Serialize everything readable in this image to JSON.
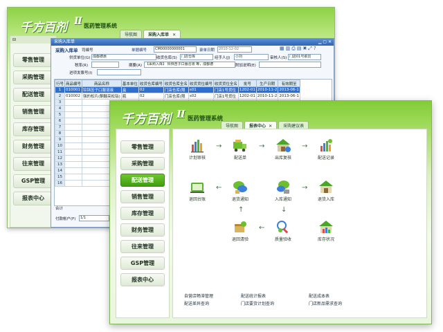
{
  "back_window": {
    "app_title": "医药管理系统",
    "logo_text": "千方百剂",
    "logo_version": "Ⅱ",
    "tabs": [
      {
        "label": "导航图"
      },
      {
        "label": "采购入库单"
      }
    ],
    "side_menu": [
      {
        "label": "零售管理"
      },
      {
        "label": "采购管理"
      },
      {
        "label": "配送管理"
      },
      {
        "label": "销售管理"
      },
      {
        "label": "库存管理"
      },
      {
        "label": "财务管理"
      },
      {
        "label": "往来管理"
      },
      {
        "label": "GSP管理"
      },
      {
        "label": "报表中心"
      }
    ],
    "doc_window": {
      "title": "采购入库单",
      "subtitle": "采购入库单",
      "tiny_label": "司编号",
      "order_no_label": "单据编号",
      "order_no_value": "CM00000000001",
      "date_label": "录单日期",
      "date_value": "2010-12-02",
      "supplier_label": "供货单位(G)",
      "supplier_value": "成都德惠",
      "warehouse_label": "收货仓库(S)",
      "warehouse_value": "门店仓库",
      "handler_label": "经手人(J)",
      "handler_value": "小刘",
      "reviewer_label": "审核人(S)",
      "reviewer_value": "门店01号职员",
      "tax_label": "税率(R)",
      "summary_label": "摘要(A)",
      "summary_value": "【采购入库】 铃铛苦子口服溶液 等，成都德",
      "extra_label": "附加说明(E)",
      "invoice_label": "进项发票号(I)",
      "columns": [
        "行号",
        "商品编号",
        "商品名称",
        "基本单位",
        "收货仓库编号",
        "收货仓库全名",
        "收货货位编号",
        "收货货位全名",
        "批号",
        "生产日期",
        "有效期至"
      ],
      "rows": [
        [
          "1",
          "010001",
          "铃铛苦子口服溶液",
          "盒",
          "02",
          "门店仓库(限",
          "s01",
          "门店1号货位",
          "1202-01",
          "2010-11-2",
          "2013-06-1"
        ],
        [
          "2",
          "010002",
          "强的松片(酮酸亮松钴)",
          "瓶",
          "02",
          "门店仓库(限",
          "s02",
          "门店1号货位",
          "1202-01",
          "2010-11-2",
          "2013-06-1"
        ],
        [
          "3",
          "",
          "",
          "",
          "",
          "",
          "",
          "",
          "",
          "",
          ""
        ],
        [
          "4",
          "",
          "",
          "",
          "",
          "",
          "",
          "",
          "",
          "",
          ""
        ],
        [
          "5",
          "",
          "",
          "",
          "",
          "",
          "",
          "",
          "",
          "",
          ""
        ],
        [
          "6",
          "",
          "",
          "",
          "",
          "",
          "",
          "",
          "",
          "",
          ""
        ],
        [
          "7",
          "",
          "",
          "",
          "",
          "",
          "",
          "",
          "",
          "",
          ""
        ],
        [
          "8",
          "",
          "",
          "",
          "",
          "",
          "",
          "",
          "",
          "",
          ""
        ],
        [
          "9",
          "",
          "",
          "",
          "",
          "",
          "",
          "",
          "",
          "",
          ""
        ],
        [
          "10",
          "",
          "",
          "",
          "",
          "",
          "",
          "",
          "",
          "",
          ""
        ],
        [
          "11",
          "",
          "",
          "",
          "",
          "",
          "",
          "",
          "",
          "",
          ""
        ],
        [
          "12",
          "",
          "",
          "",
          "",
          "",
          "",
          "",
          "",
          "",
          ""
        ],
        [
          "13",
          "",
          "",
          "",
          "",
          "",
          "",
          "",
          "",
          "",
          ""
        ],
        [
          "14",
          "",
          "",
          "",
          "",
          "",
          "",
          "",
          "",
          "",
          ""
        ],
        [
          "15",
          "",
          "",
          "",
          "",
          "",
          "",
          "",
          "",
          "",
          ""
        ],
        [
          "16",
          "",
          "",
          "",
          "",
          "",
          "",
          "",
          "",
          "",
          ""
        ]
      ],
      "total_label": "合计",
      "pay_account_label": "付款帐户(F)",
      "pay_account_value": "1/1"
    }
  },
  "front_window": {
    "app_title": "医药管理系统",
    "logo_text": "千方百剂",
    "logo_version": "Ⅱ",
    "tabs": [
      {
        "label": "导航图"
      },
      {
        "label": "报表中心"
      },
      {
        "label": "采购建议表"
      }
    ],
    "side_menu": [
      {
        "label": "零售管理",
        "active": false
      },
      {
        "label": "采购管理",
        "active": false
      },
      {
        "label": "配送管理",
        "active": true
      },
      {
        "label": "销售管理",
        "active": false
      },
      {
        "label": "库存管理",
        "active": false
      },
      {
        "label": "财务管理",
        "active": false
      },
      {
        "label": "往来管理",
        "active": false
      },
      {
        "label": "GSP管理",
        "active": false
      },
      {
        "label": "报表中心",
        "active": false
      }
    ],
    "flow_nodes": [
      {
        "label": "计划审核",
        "icon": "plan-chart-icon"
      },
      {
        "label": "配送单",
        "icon": "truck-icon"
      },
      {
        "label": "出库复核",
        "icon": "warehouse-check-icon"
      },
      {
        "label": "配送记录",
        "icon": "delivery-record-icon"
      },
      {
        "label": "退回台账",
        "icon": "return-ledger-icon"
      },
      {
        "label": "退货通知",
        "icon": "return-notice-icon"
      },
      {
        "label": "入库通知",
        "icon": "inbound-notice-icon"
      },
      {
        "label": "退货入库",
        "icon": "return-inbound-icon"
      },
      {
        "label": "退回清验",
        "icon": "return-inspect-icon"
      },
      {
        "label": "质量验收",
        "icon": "quality-check-icon"
      },
      {
        "label": "库存状况",
        "icon": "stock-status-icon"
      }
    ],
    "report_links": [
      {
        "label": "自营店畅滞管理"
      },
      {
        "label": "配送统计报表"
      },
      {
        "label": "配送成本表"
      },
      {
        "label": "配送差异查询"
      },
      {
        "label": "门店要货计划查询"
      },
      {
        "label": "门店新品需求查询"
      }
    ]
  },
  "colors": {
    "green_dark": "#3f9d10",
    "green_light": "#b7e57e",
    "selected_row": "#2f6fd0"
  }
}
